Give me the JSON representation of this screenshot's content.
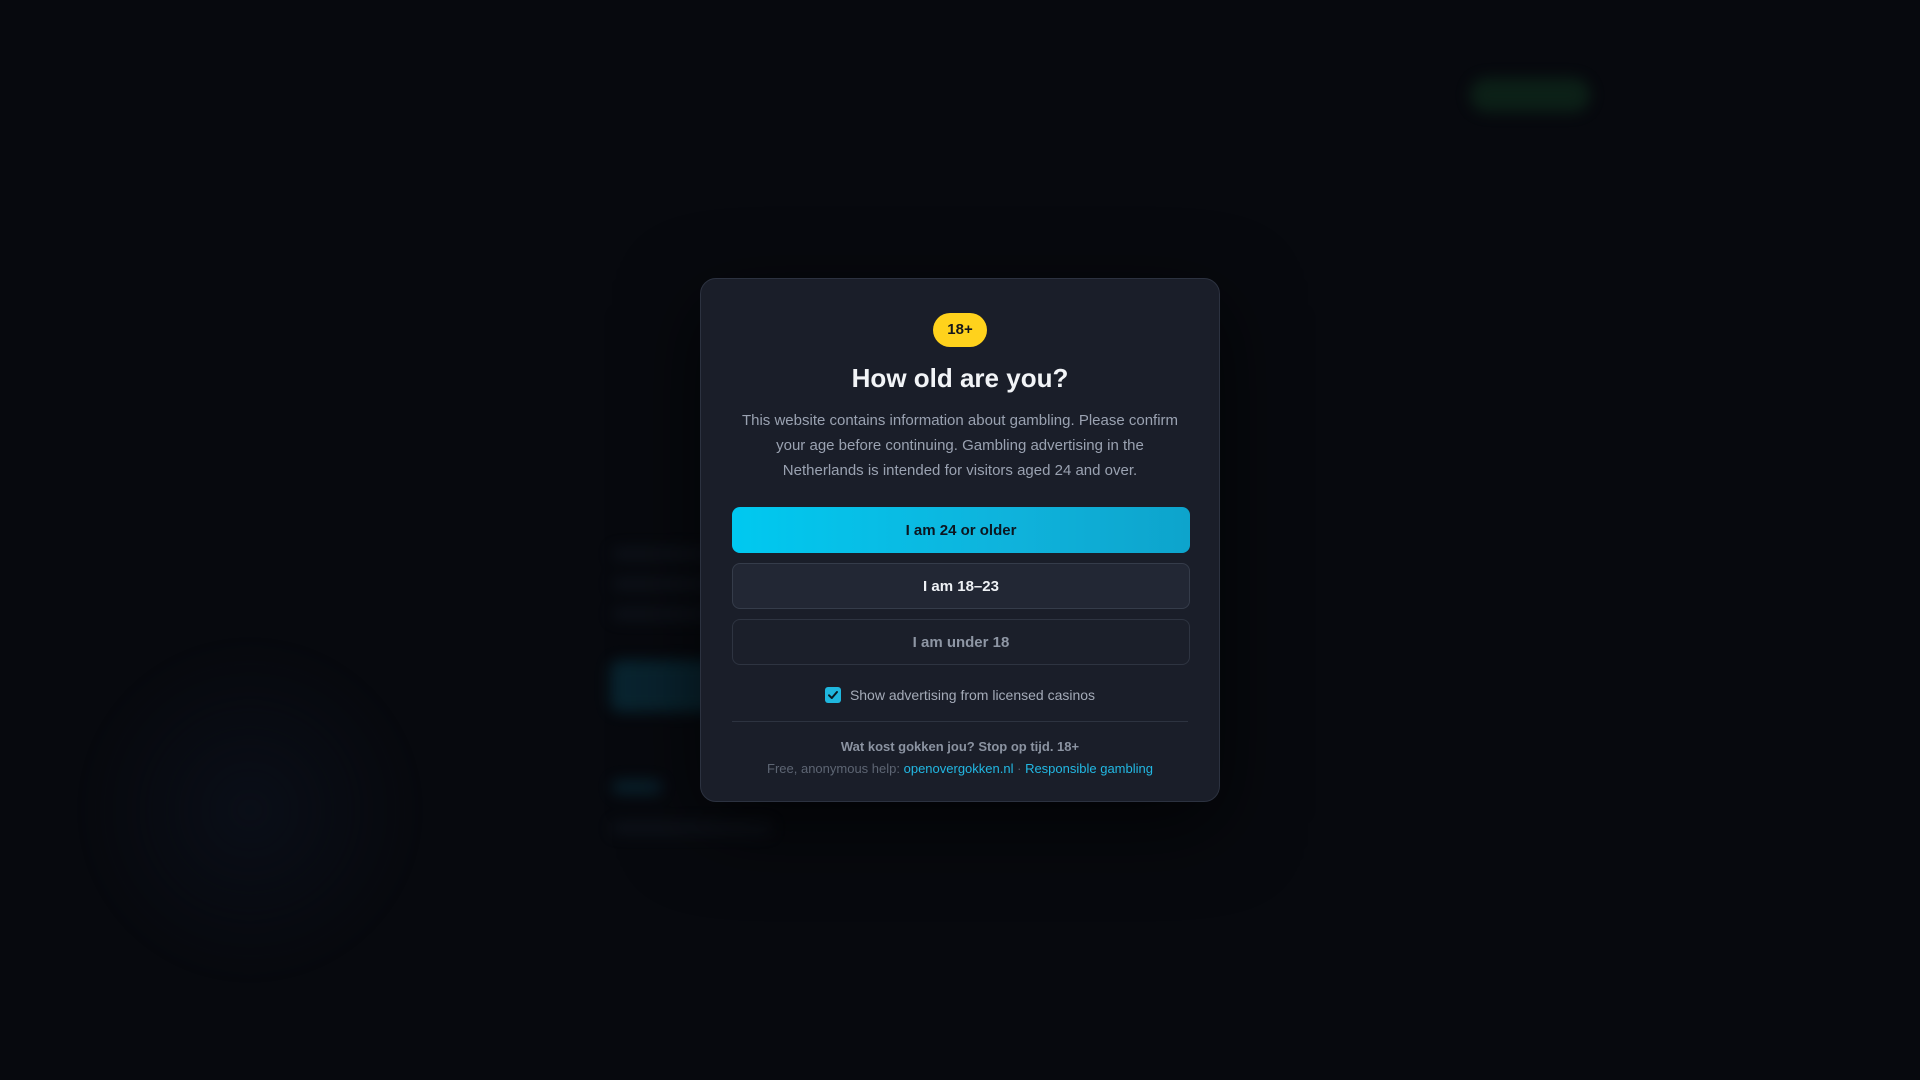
{
  "background": {
    "logo": "",
    "nav_items": [
      "",
      "",
      "",
      "",
      "",
      "",
      "",
      "",
      "",
      ""
    ],
    "hero_line_1": "",
    "hero_line_2": ""
  },
  "modal": {
    "badge": "18+",
    "title": "How old are you?",
    "description": "This website contains information about gambling. Please confirm your age before continuing. Gambling advertising in the Netherlands is intended for visitors aged 24 and over.",
    "buttons": {
      "primary": "I am 24 or older",
      "secondary": "I am 18–23",
      "tertiary": "I am under 18"
    },
    "consent": {
      "label": "Show advertising from licensed casinos",
      "checked": true
    },
    "warning": "Wat kost gokken jou? Stop op tijd. 18+",
    "help": {
      "prefix": "Free, anonymous help:",
      "link_1": "openovergokken.nl",
      "separator": "·",
      "link_2": "Responsible gambling"
    }
  },
  "colors": {
    "badge": "#ffd21c",
    "primary_button": "#00c9f0",
    "link": "#22b8e3",
    "modal_bg": "#1a1e29",
    "page_bg": "#07090e"
  }
}
